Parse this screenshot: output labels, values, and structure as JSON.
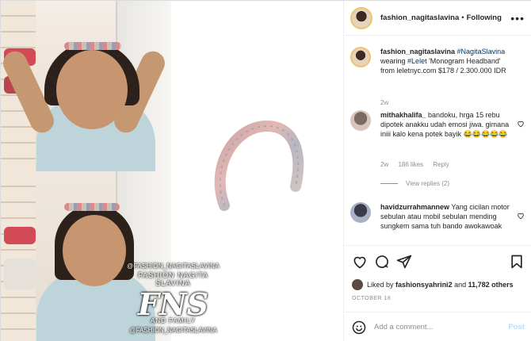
{
  "header": {
    "username": "fashion_nagitaslavina",
    "separator": "•",
    "follow_label": "Following",
    "more_icon": "more-horizontal-icon"
  },
  "caption": {
    "username": "fashion_nagitaslavina",
    "hashtag": "#NagitaSlavina",
    "text_before": "wearing",
    "product_tag": "#Lelet",
    "text_after": "'Monogram Headband' from leletnyc.com $178 / 2.300.000 IDR",
    "time": "2w"
  },
  "comments": [
    {
      "username": "mithakhalifa_",
      "text": "bandoku, hrga 15 rebu dipotek anakku udah emosi jiwa. gimana iniii kalo kena potek bayik 😂😂😂😂😂",
      "time": "2w",
      "likes": "186 likes",
      "reply_label": "Reply",
      "view_replies": "View replies (2)"
    },
    {
      "username": "havidzurrahmannew",
      "text": "Yang cicilan motor sebulan atau mobil sebulan mending sungkem sama tuh bando awokawoak"
    }
  ],
  "likes": {
    "prefix": "Liked by",
    "user": "fashionsyahrini2",
    "suffix": "and",
    "count": "11,782 others"
  },
  "date": "OCTOBER 18",
  "add_comment": {
    "placeholder": "Add a comment...",
    "post_label": "Post"
  },
  "watermark": {
    "handle_top": "@FASHION_NAGITASLAVINA",
    "name": "FASHION NAGITA SLAVINA",
    "logo": "FNS",
    "family": "AND FAMILY",
    "handle_bottom": "@FASHION_NAGITASLAVINA"
  },
  "colors": {
    "link": "#00376b",
    "muted": "#8e8e8e",
    "post_disabled": "#b2dffc",
    "story_ring": "#f0c36f"
  }
}
